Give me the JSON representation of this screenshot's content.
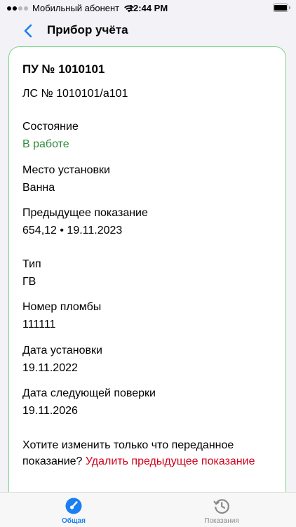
{
  "status_bar": {
    "carrier": "Мобильный абонент",
    "time": "12:44 PM"
  },
  "nav": {
    "title": "Прибор учёта"
  },
  "meter": {
    "pu_number": "ПУ № 1010101",
    "ls_number": "ЛС № 1010101/а101",
    "state_label": "Состояние",
    "state_value": "В работе",
    "location_label": "Место установки",
    "location_value": "Ванна",
    "prev_reading_label": "Предыдущее показание",
    "prev_reading_value": "654,12 • 19.11.2023",
    "type_label": "Тип",
    "type_value": "ГВ",
    "seal_label": "Номер пломбы",
    "seal_value": "111111",
    "install_date_label": "Дата установки",
    "install_date_value": "19.11.2022",
    "next_check_label": "Дата следующей поверки",
    "next_check_value": "19.11.2026"
  },
  "question": {
    "text": "Хотите изменить только что переданное показание? ",
    "link": "Удалить предыдущее показание"
  },
  "tabs": [
    {
      "label": "Общая",
      "icon": "gauge-icon",
      "active": true
    },
    {
      "label": "Показания",
      "icon": "history-icon",
      "active": false
    }
  ],
  "colors": {
    "accent": "#1a7ff2",
    "status_green": "#2e8b3e",
    "card_border": "#7dd58a",
    "danger": "#d0021b"
  }
}
